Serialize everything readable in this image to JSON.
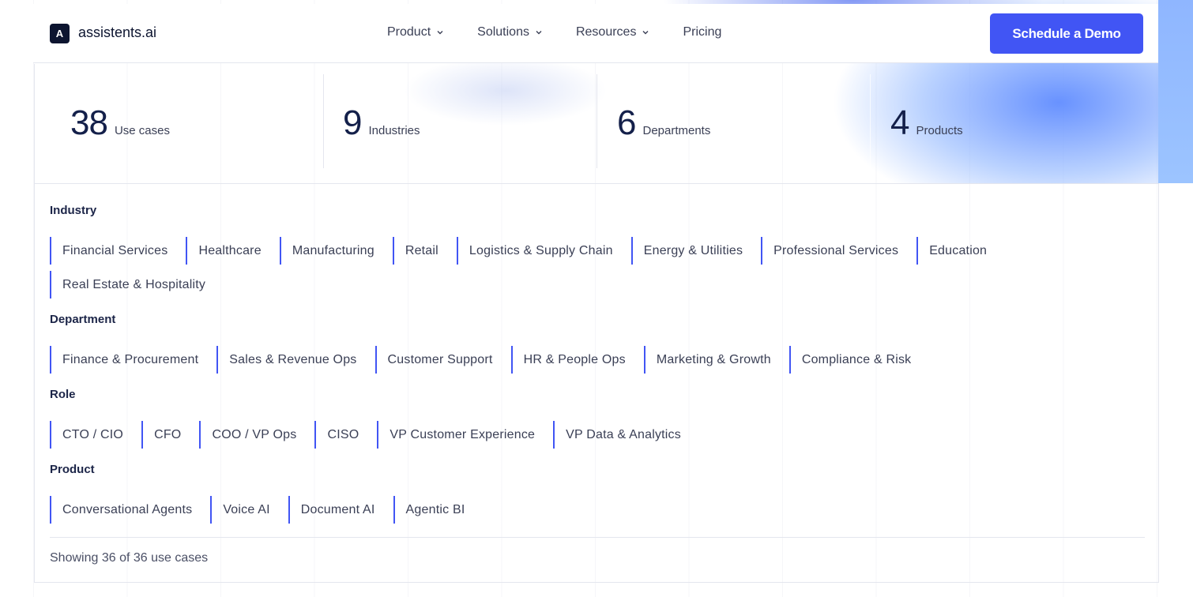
{
  "brand": {
    "logo_letter": "A",
    "name": "assistents.ai"
  },
  "nav": {
    "items": [
      {
        "label": "Product",
        "has_dropdown": true
      },
      {
        "label": "Solutions",
        "has_dropdown": true
      },
      {
        "label": "Resources",
        "has_dropdown": true
      },
      {
        "label": "Pricing",
        "has_dropdown": false
      }
    ],
    "cta_label": "Schedule a Demo"
  },
  "stats": [
    {
      "value": "38",
      "label": "Use cases"
    },
    {
      "value": "9",
      "label": "Industries"
    },
    {
      "value": "6",
      "label": "Departments"
    },
    {
      "value": "4",
      "label": "Products"
    }
  ],
  "filters": {
    "industry": {
      "title": "Industry",
      "options": [
        "Financial Services",
        "Healthcare",
        "Manufacturing",
        "Retail",
        "Logistics & Supply Chain",
        "Energy & Utilities",
        "Professional Services",
        "Education",
        "Real Estate & Hospitality"
      ]
    },
    "department": {
      "title": "Department",
      "options": [
        "Finance & Procurement",
        "Sales & Revenue Ops",
        "Customer Support",
        "HR & People Ops",
        "Marketing & Growth",
        "Compliance & Risk"
      ]
    },
    "role": {
      "title": "Role",
      "options": [
        "CTO / CIO",
        "CFO",
        "COO / VP Ops",
        "CISO",
        "VP Customer Experience",
        "VP Data & Analytics"
      ]
    },
    "product": {
      "title": "Product",
      "options": [
        "Conversational Agents",
        "Voice AI",
        "Document AI",
        "Agentic BI"
      ]
    }
  },
  "results": {
    "text": "Showing 36 of 36 use cases"
  },
  "colors": {
    "accent": "#4155f4",
    "navy": "#14204a"
  }
}
